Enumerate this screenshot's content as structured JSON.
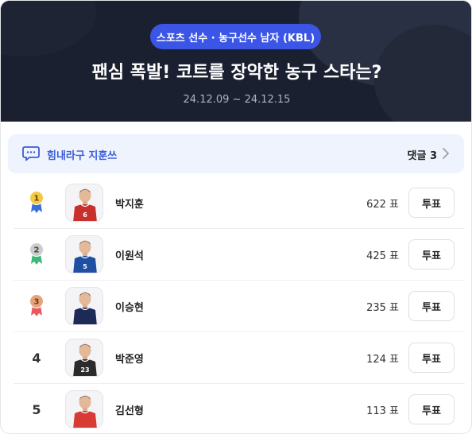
{
  "hero": {
    "category": "스포츠 선수 · 농구선수 남자 (KBL)",
    "title": "팬심 폭발! 코트를 장악한 농구 스타는?",
    "date_range": "24.12.09 ~ 24.12.15"
  },
  "comments": {
    "title": "힘내라구 지훈쓰",
    "count_label": "댓글 3",
    "icon": "comment-icon"
  },
  "colors": {
    "accent": "#3b55e6",
    "hero_bg": "#1b2030",
    "gold": "#f5c843",
    "silver": "#c8ccd3",
    "bronze": "#e8a27e",
    "ribbon_blue": "#3b6fd8",
    "ribbon_green": "#3cb878",
    "ribbon_red": "#e8585e"
  },
  "players": [
    {
      "rank": "1",
      "medal": "gold",
      "name": "박지훈",
      "votes": "622 표",
      "vote_label": "투표",
      "jersey_number": "6",
      "jersey_color": "#c8302e"
    },
    {
      "rank": "2",
      "medal": "silver",
      "name": "이원석",
      "votes": "425 표",
      "vote_label": "투표",
      "jersey_number": "5",
      "jersey_color": "#1f4fa3"
    },
    {
      "rank": "3",
      "medal": "bronze",
      "name": "이승현",
      "votes": "235 표",
      "vote_label": "투표",
      "jersey_number": "",
      "jersey_color": "#1c2a57"
    },
    {
      "rank": "4",
      "medal": "",
      "name": "박준영",
      "votes": "124 표",
      "vote_label": "투표",
      "jersey_number": "23",
      "jersey_color": "#2b2b2b"
    },
    {
      "rank": "5",
      "medal": "",
      "name": "김선형",
      "votes": "113 표",
      "vote_label": "투표",
      "jersey_number": "",
      "jersey_color": "#d83a34"
    }
  ]
}
